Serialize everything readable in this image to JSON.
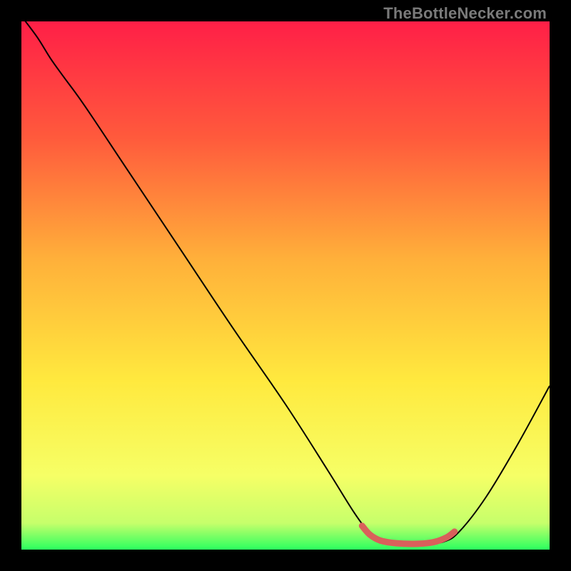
{
  "watermark": "TheBottleNecker.com",
  "chart_data": {
    "type": "line",
    "title": "",
    "xlabel": "",
    "ylabel": "",
    "xlim": [
      0,
      100
    ],
    "ylim": [
      0,
      100
    ],
    "gradient_stops": [
      {
        "offset": 0,
        "color": "#ff1f47"
      },
      {
        "offset": 22,
        "color": "#ff5a3c"
      },
      {
        "offset": 45,
        "color": "#ffb03a"
      },
      {
        "offset": 68,
        "color": "#ffe93e"
      },
      {
        "offset": 86,
        "color": "#f6ff66"
      },
      {
        "offset": 95,
        "color": "#c6ff6b"
      },
      {
        "offset": 100,
        "color": "#2bff5f"
      }
    ],
    "series": [
      {
        "name": "bottleneck-curve",
        "color": "#000000",
        "points": [
          {
            "x": 0.0,
            "y": 101.0
          },
          {
            "x": 3.0,
            "y": 97.0
          },
          {
            "x": 5.5,
            "y": 93.0
          },
          {
            "x": 8.0,
            "y": 89.5
          },
          {
            "x": 12.0,
            "y": 84.0
          },
          {
            "x": 20.0,
            "y": 72.0
          },
          {
            "x": 30.0,
            "y": 57.0
          },
          {
            "x": 40.0,
            "y": 42.0
          },
          {
            "x": 50.0,
            "y": 27.5
          },
          {
            "x": 58.0,
            "y": 15.0
          },
          {
            "x": 63.0,
            "y": 7.0
          },
          {
            "x": 66.0,
            "y": 3.0
          },
          {
            "x": 68.0,
            "y": 1.5
          },
          {
            "x": 72.0,
            "y": 1.0
          },
          {
            "x": 76.0,
            "y": 1.0
          },
          {
            "x": 80.0,
            "y": 1.5
          },
          {
            "x": 83.0,
            "y": 3.5
          },
          {
            "x": 88.0,
            "y": 10.0
          },
          {
            "x": 94.0,
            "y": 20.0
          },
          {
            "x": 100.0,
            "y": 31.0
          }
        ]
      }
    ],
    "highlight": {
      "name": "trough-highlight",
      "color": "#d9605b",
      "stroke_width": 9,
      "points": [
        {
          "x": 64.5,
          "y": 4.5
        },
        {
          "x": 66.0,
          "y": 2.8
        },
        {
          "x": 68.0,
          "y": 1.7
        },
        {
          "x": 71.0,
          "y": 1.2
        },
        {
          "x": 75.0,
          "y": 1.1
        },
        {
          "x": 78.0,
          "y": 1.4
        },
        {
          "x": 80.5,
          "y": 2.3
        },
        {
          "x": 82.0,
          "y": 3.4
        }
      ]
    }
  }
}
